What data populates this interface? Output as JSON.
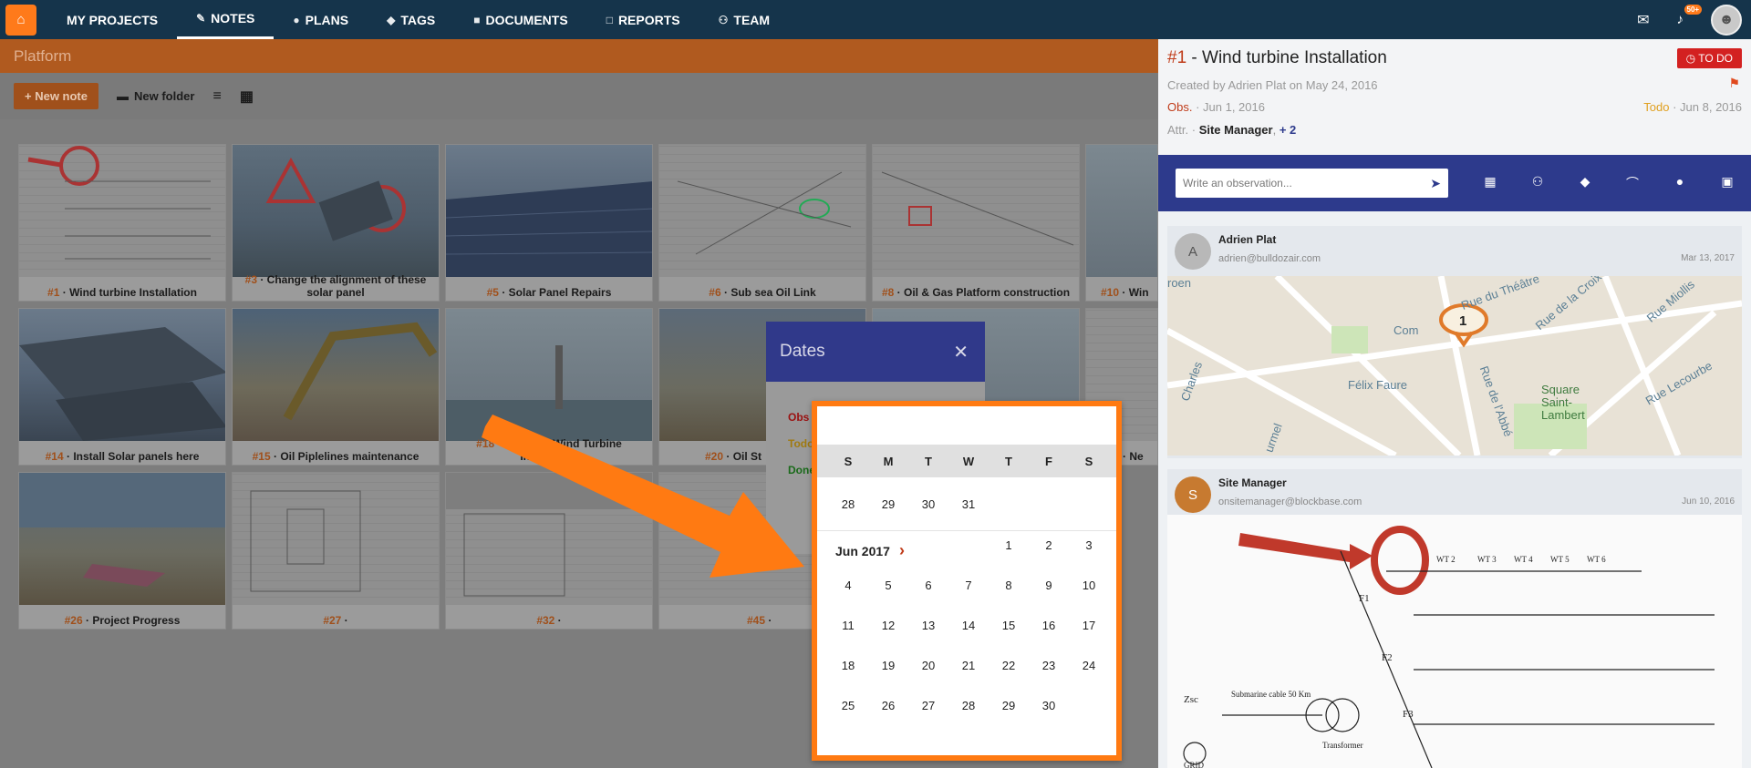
{
  "topbar": {
    "logo": "⌂",
    "nav": [
      {
        "label": "MY PROJECTS",
        "icon": "",
        "active": false
      },
      {
        "label": "NOTES",
        "icon": "✎",
        "active": true
      },
      {
        "label": "PLANS",
        "icon": "●",
        "active": false
      },
      {
        "label": "TAGS",
        "icon": "◆",
        "active": false
      },
      {
        "label": "DOCUMENTS",
        "icon": "■",
        "active": false
      },
      {
        "label": "REPORTS",
        "icon": "□",
        "active": false
      },
      {
        "label": "TEAM",
        "icon": "⚇",
        "active": false
      }
    ],
    "mail_icon": "✉",
    "bell_icon": "♪",
    "notif_badge": "50+"
  },
  "platform": {
    "title": "Platform"
  },
  "toolbar": {
    "new_note": "+ New note",
    "new_folder": "New folder",
    "folder_icon": "▬",
    "filter_icon": "≡",
    "grid_icon": "▦"
  },
  "cards": [
    {
      "num": "#1",
      "label": "Wind turbine Installation"
    },
    {
      "num": "#3",
      "label": "Change the alignment of these solar panel"
    },
    {
      "num": "#5",
      "label": "Solar Panel Repairs"
    },
    {
      "num": "#6",
      "label": "Sub sea Oil Link"
    },
    {
      "num": "#8",
      "label": "Oil & Gas Platform construction"
    },
    {
      "num": "#10",
      "label": "Win"
    },
    {
      "num": "#14",
      "label": "Install Solar panels here"
    },
    {
      "num": "#15",
      "label": "Oil Piplelines maintenance"
    },
    {
      "num": "#18",
      "label": "Offshore Wind Turbine Installation"
    },
    {
      "num": "#20",
      "label": "Oil St"
    },
    {
      "num": "",
      "label": "Ne"
    },
    {
      "num": "#26",
      "label": "Project Progress"
    },
    {
      "num": "#27",
      "label": ""
    },
    {
      "num": "#32",
      "label": ""
    },
    {
      "num": "#45",
      "label": ""
    }
  ],
  "dates_dialog": {
    "title": "Dates",
    "close_icon": "✕",
    "obs_label": "Obs",
    "todo_label": "Todo",
    "done_label": "Done"
  },
  "calendar": {
    "weekdays": [
      "S",
      "M",
      "T",
      "W",
      "T",
      "F",
      "S"
    ],
    "prev_row": [
      "28",
      "29",
      "30",
      "31",
      "",
      "",
      ""
    ],
    "month_label": "Jun 2017",
    "chevron": "›",
    "first_row": [
      "",
      "",
      "",
      "",
      "1",
      "2",
      "3"
    ],
    "rows": [
      [
        "4",
        "5",
        "6",
        "7",
        "8",
        "9",
        "10"
      ],
      [
        "11",
        "12",
        "13",
        "14",
        "15",
        "16",
        "17"
      ],
      [
        "18",
        "19",
        "20",
        "21",
        "22",
        "23",
        "24"
      ],
      [
        "25",
        "26",
        "27",
        "28",
        "29",
        "30",
        ""
      ]
    ]
  },
  "rpanel": {
    "num": "#1",
    "title": " - Wind turbine Installation",
    "status": "TO DO",
    "status_icon": "◷",
    "flag": "⚑",
    "created": "Created by Adrien Plat on May 24, 2016",
    "obs_label": "Obs.",
    "obs_date": "· Jun 1, 2016",
    "todo_label": "Todo",
    "todo_date": "· Jun 8, 2016",
    "attr_label": "Attr. ·",
    "attr_value": "Site Manager",
    "attr_more": "+ 2",
    "obs_placeholder": "Write an observation...",
    "send_icon": "➤",
    "bar_icons": [
      "▦",
      "⚇",
      "◆",
      "⌒",
      "●",
      "▣"
    ],
    "feed": [
      {
        "name": "Adrien Plat",
        "email": "adrien@bulldozair.com",
        "date": "Mar 13, 2017",
        "avatar": "A"
      },
      {
        "name": "Site Manager",
        "email": "onsitemanager@blockbase.com",
        "date": "Jun 10, 2016",
        "avatar": "S"
      }
    ],
    "map_labels": [
      "Com",
      "Félix Faure",
      "Square Saint-Lambert",
      "Rue Lecourbe",
      "Rue Miollis",
      "Rue de la Croix",
      "Rue du Théâtre",
      "roen",
      "Charles",
      "Rue de l'Abbé",
      "urmel",
      "1"
    ],
    "plan_labels": [
      "WT 2",
      "WT 3",
      "WT 4",
      "WT 5",
      "WT 6",
      "F1",
      "F2",
      "F3",
      "Submarine cable 50 Km",
      "Zsc",
      "Transformer",
      "GRID"
    ]
  }
}
